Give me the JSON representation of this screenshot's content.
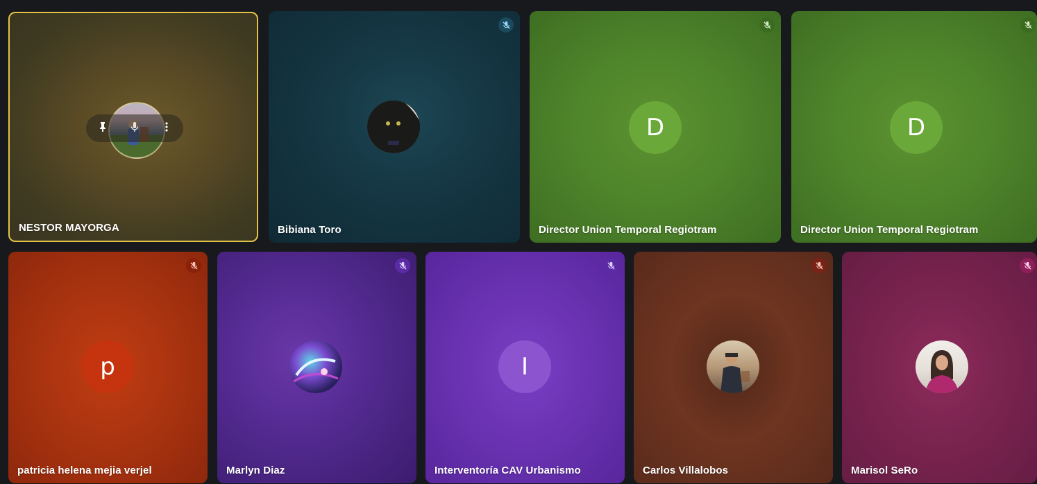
{
  "participants": [
    {
      "name": "NESTOR MAYORGA",
      "avatar": "photo",
      "avatar_icon": "person-landscape-photo",
      "muted": false,
      "speaking": true,
      "tile_color": "#5a4b25"
    },
    {
      "name": "Bibiana Toro",
      "avatar": "photo",
      "avatar_icon": "black-cat-photo",
      "muted": true,
      "mute_color": "#1a4a5c",
      "tile_color": "#153643"
    },
    {
      "name": "Director Union Temporal Regiotram",
      "avatar": "letter",
      "initial": "D",
      "avatar_bg": "#6aa83a",
      "muted": true,
      "mute_color": "#3b6b1f",
      "tile_color": "#4f852b"
    },
    {
      "name": "Director Union Temporal Regiotram",
      "avatar": "letter",
      "initial": "D",
      "avatar_bg": "#6aa83a",
      "muted": true,
      "mute_color": "#3b6b1f",
      "tile_color": "#4f852b"
    },
    {
      "name": "patricia helena mejia verjel",
      "avatar": "letter",
      "initial": "p",
      "avatar_bg": "#c5340e",
      "muted": true,
      "mute_color": "#8a220a",
      "tile_color": "#ab3410"
    },
    {
      "name": "Marlyn Diaz",
      "avatar": "photo",
      "avatar_icon": "colorful-photo",
      "muted": true,
      "mute_color": "#5b2ba6",
      "tile_color": "#532a90"
    },
    {
      "name": "Interventoría CAV Urbanismo",
      "avatar": "letter",
      "initial": "I",
      "avatar_bg": "#8d54cf",
      "muted": true,
      "mute_color": "#5b2ba6",
      "tile_color": "#6a33b3"
    },
    {
      "name": "Carlos Villalobos",
      "avatar": "photo",
      "avatar_icon": "man-photo",
      "muted": true,
      "mute_color": "#7a2216",
      "tile_color": "#6e3520"
    },
    {
      "name": "Marisol SeRo",
      "avatar": "photo",
      "avatar_icon": "woman-photo",
      "muted": true,
      "mute_color": "#8e1f5a",
      "tile_color": "#7a2450"
    }
  ],
  "hover_controls": {
    "icons": [
      "pin-icon",
      "microphone-icon",
      "more-options-icon"
    ]
  },
  "colors": {
    "background": "#17191c",
    "active_speaker_border": "#e3c347"
  }
}
